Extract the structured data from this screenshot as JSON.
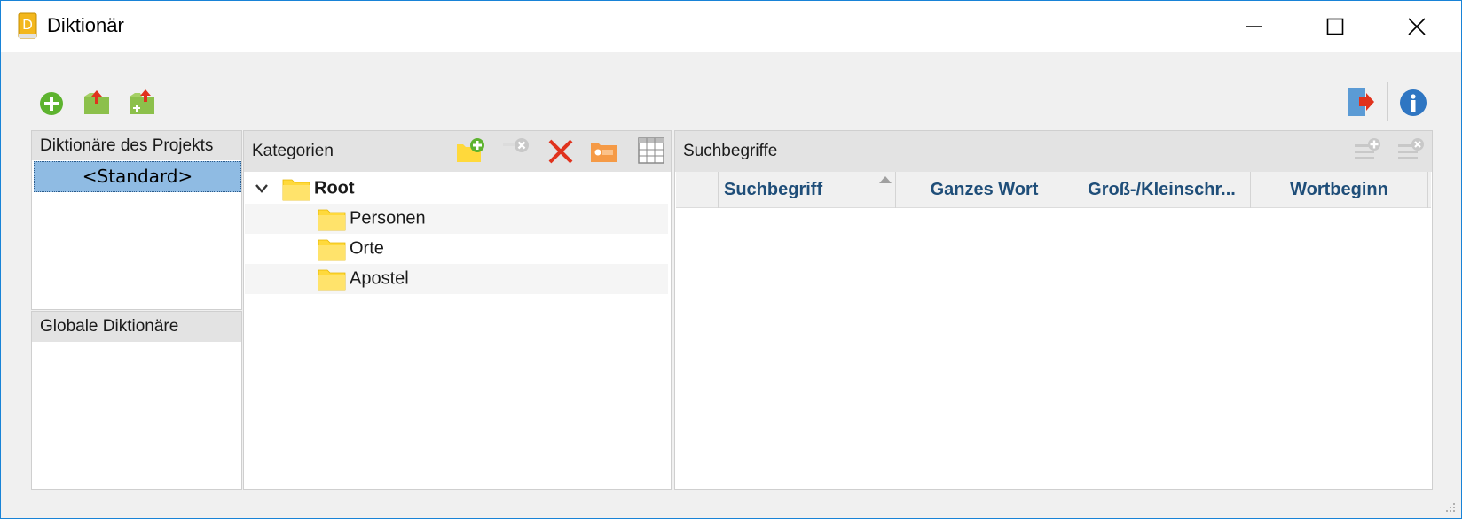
{
  "window": {
    "title": "Diktionär",
    "app_icon_letter": "D"
  },
  "toolbar": {
    "left": [
      "add-icon",
      "export-icon",
      "import-icon"
    ],
    "right": [
      "exit-icon",
      "info-icon"
    ]
  },
  "project_dictionaries": {
    "header": "Diktionäre des Projekts",
    "items": [
      "<Standard>"
    ],
    "selected": 0
  },
  "global_dictionaries": {
    "header": "Globale Diktionäre",
    "items": []
  },
  "categories": {
    "header": "Kategorien",
    "tools": [
      "new-category-icon",
      "remove-icon",
      "delete-icon",
      "tag-icon",
      "table-icon"
    ],
    "tree": {
      "root": "Root",
      "children": [
        "Personen",
        "Orte",
        "Apostel"
      ]
    }
  },
  "search_terms": {
    "header": "Suchbegriffe",
    "tools": [
      "add-row-icon",
      "remove-row-icon"
    ],
    "columns": [
      "Suchbegriff",
      "Ganzes Wort",
      "Groß-/Kleinschr...",
      "Wortbeginn"
    ],
    "rows": []
  },
  "colors": {
    "accent": "#1883d7",
    "selection": "#8fbbe3",
    "header_text": "#1f4e79",
    "folder": "#ffd93b"
  }
}
